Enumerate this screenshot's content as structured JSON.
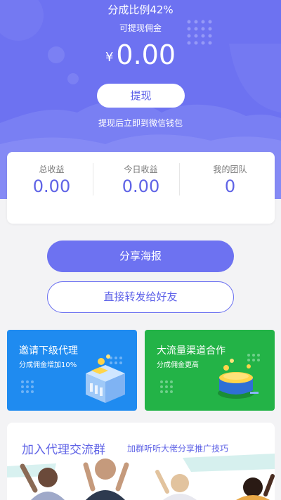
{
  "header": {
    "ratio_text": "分成比例42%",
    "withdrawable_label": "可提现佣金",
    "currency_symbol": "¥",
    "amount": "0.00",
    "withdraw_button": "提现",
    "withdraw_note": "提现后立即到微信钱包"
  },
  "stats": [
    {
      "label": "总收益",
      "value": "0.00"
    },
    {
      "label": "今日收益",
      "value": "0.00"
    },
    {
      "label": "我的团队",
      "value": "0"
    }
  ],
  "actions": {
    "share_poster": "分享海报",
    "forward_friends": "直接转发给好友"
  },
  "promos": [
    {
      "title": "邀请下级代理",
      "subtitle": "分成佣金增加10%",
      "icon": "building-icon"
    },
    {
      "title": "大流量渠道合作",
      "subtitle": "分成佣金更高",
      "icon": "coin-pot-icon"
    }
  ],
  "group": {
    "title": "加入代理交流群",
    "subtitle": "加群听听大佬分享推广技巧"
  },
  "colors": {
    "brand": "#6d72f1",
    "blue_card": "#1f8bf0",
    "green_card": "#23b347"
  }
}
